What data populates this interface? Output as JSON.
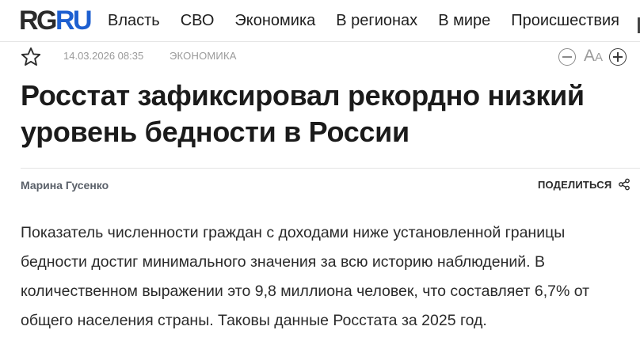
{
  "brand": {
    "logo_part1": "RG",
    "logo_part2": "RU",
    "colors": {
      "logo_dark": "#2b2b2b",
      "logo_blue": "#1d5fd0",
      "accent_red": "#d0021b"
    }
  },
  "nav": {
    "items": [
      {
        "label": "Власть"
      },
      {
        "label": "СВО"
      },
      {
        "label": "Экономика"
      },
      {
        "label": "В регионах"
      },
      {
        "label": "В мире"
      },
      {
        "label": "Происшествия"
      }
    ]
  },
  "meta": {
    "favorite_icon": "star-outline-icon",
    "date": "14.03.2026 08:35",
    "rubric": "ЭКОНОМИКА",
    "font_controls": {
      "decrease_icon": "minus-circle-icon",
      "font_size_icon": "font-size-icon",
      "font_size_big": "A",
      "font_size_small": "A",
      "increase_icon": "plus-circle-icon"
    }
  },
  "article": {
    "title": "Росстат зафиксировал рекордно низкий уровень бедности в России",
    "author": "Марина Гусенко",
    "share_label": "ПОДЕЛИТЬСЯ",
    "share_icon": "share-icon",
    "lead": "Показатель численности граждан с доходами ниже установленной границы бедности достиг минимального значения за всю историю наблюдений. В количественном выражении это 9,8 миллиона человек, что составляет 6,7% от общего населения страны. Таковы данные Росстата за 2025 год."
  }
}
